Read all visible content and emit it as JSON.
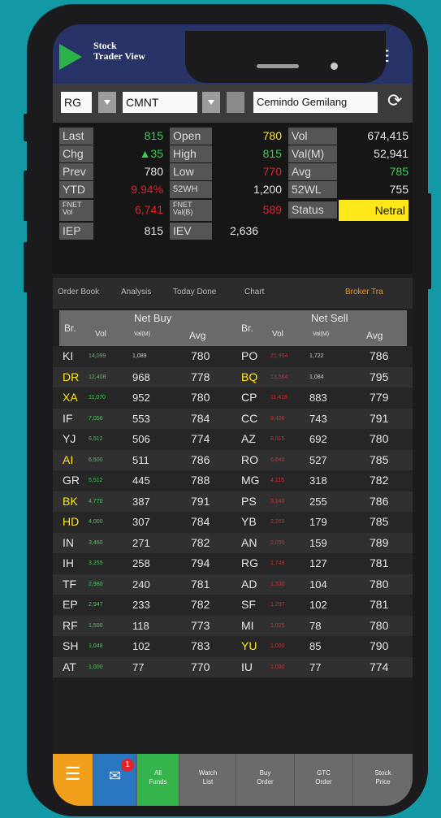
{
  "app": {
    "title_line1": "Stock",
    "title_line2": "Trader View"
  },
  "toolbar": {
    "board": "RG",
    "code": "CMNT",
    "company": "Cemindo Gemilang"
  },
  "quote": {
    "last_label": "Last",
    "last": "815",
    "chg_label": "Chg",
    "chg": "▲35",
    "prev_label": "Prev",
    "prev": "780",
    "ytd_label": "YTD",
    "ytd": "9.94%",
    "fnet_label": "FNET Vol",
    "fnet": "6,741",
    "iep_label": "IEP",
    "iep": "815",
    "open_label": "Open",
    "open": "780",
    "high_label": "High",
    "high": "815",
    "low_label": "Low",
    "low": "770",
    "wk52h_label": "52WH",
    "wk52h": "1,200",
    "fnetval_label": "FNET Val(B)",
    "fnetval": "589",
    "iev_label": "IEV",
    "iev": "2,636",
    "vol_label": "Vol",
    "vol": "674,415",
    "valm_label": "Val(M)",
    "valm": "52,941",
    "avg_label": "Avg",
    "avg": "785",
    "wk52l_label": "52WL",
    "wk52l": "755",
    "status_label": "Status",
    "status": "Netral"
  },
  "tabs": [
    "Order Book",
    "Analysis",
    "Today Done",
    "Chart",
    "Broker Tra"
  ],
  "table_header": {
    "br": "Br.",
    "net_buy": "Net Buy",
    "net_sell": "Net Sell",
    "vol": "Vol",
    "valm": "Val(M)",
    "avg": "Avg"
  },
  "rows": [
    {
      "b": "KI",
      "bv": "14,099",
      "bm": "1,089",
      "ba": "780",
      "s": "PO",
      "sv": "21,954",
      "sm": "1,722",
      "sa": "786"
    },
    {
      "b": "DR",
      "bv": "12,408",
      "bm": "968",
      "ba": "778",
      "s": "BQ",
      "sv": "13,564",
      "sm": "1,084",
      "sa": "795"
    },
    {
      "b": "XA",
      "bv": "11,070",
      "bm": "952",
      "ba": "780",
      "s": "CP",
      "sv": "11,418",
      "sm": "883",
      "sa": "779"
    },
    {
      "b": "IF",
      "bv": "7,056",
      "bm": "553",
      "ba": "784",
      "s": "CC",
      "sv": "9,406",
      "sm": "743",
      "sa": "791"
    },
    {
      "b": "YJ",
      "bv": "6,512",
      "bm": "506",
      "ba": "774",
      "s": "AZ",
      "sv": "8,015",
      "sm": "692",
      "sa": "780"
    },
    {
      "b": "AI",
      "bv": "6,500",
      "bm": "511",
      "ba": "786",
      "s": "RO",
      "sv": "6,640",
      "sm": "527",
      "sa": "785"
    },
    {
      "b": "GR",
      "bv": "5,512",
      "bm": "445",
      "ba": "788",
      "s": "MG",
      "sv": "4,115",
      "sm": "318",
      "sa": "782"
    },
    {
      "b": "BK",
      "bv": "4,770",
      "bm": "387",
      "ba": "791",
      "s": "PS",
      "sv": "3,140",
      "sm": "255",
      "sa": "786"
    },
    {
      "b": "HD",
      "bv": "4,000",
      "bm": "307",
      "ba": "784",
      "s": "YB",
      "sv": "2,269",
      "sm": "179",
      "sa": "785"
    },
    {
      "b": "IN",
      "bv": "3,460",
      "bm": "271",
      "ba": "782",
      "s": "AN",
      "sv": "2,000",
      "sm": "159",
      "sa": "789"
    },
    {
      "b": "IH",
      "bv": "3,255",
      "bm": "258",
      "ba": "794",
      "s": "RG",
      "sv": "1,749",
      "sm": "127",
      "sa": "781"
    },
    {
      "b": "TF",
      "bv": "2,980",
      "bm": "240",
      "ba": "781",
      "s": "AD",
      "sv": "1,330",
      "sm": "104",
      "sa": "780"
    },
    {
      "b": "EP",
      "bv": "2,947",
      "bm": "233",
      "ba": "782",
      "s": "SF",
      "sv": "1,297",
      "sm": "102",
      "sa": "781"
    },
    {
      "b": "RF",
      "bv": "1,500",
      "bm": "118",
      "ba": "773",
      "s": "MI",
      "sv": "1,025",
      "sm": "78",
      "sa": "780"
    },
    {
      "b": "SH",
      "bv": "1,048",
      "bm": "102",
      "ba": "783",
      "s": "YU",
      "sv": "1,000",
      "sm": "85",
      "sa": "790"
    },
    {
      "b": "AT",
      "bv": "1,000",
      "bm": "77",
      "ba": "770",
      "s": "IU",
      "sv": "1,000",
      "sm": "77",
      "sa": "774"
    }
  ],
  "bottom_nav": {
    "badge": "1",
    "all_funds_1": "All",
    "all_funds_2": "Funds",
    "watch_1": "Watch",
    "watch_2": "List",
    "buy_1": "Buy",
    "buy_2": "Order",
    "gtc_1": "GTC",
    "gtc_2": "Order",
    "stock_1": "Stock",
    "stock_2": "Price"
  },
  "colors": {
    "buy_green": "#35d24a",
    "sell_red": "#e0242a",
    "status_yellow": "#ffe81a",
    "top_navy": "#273366"
  }
}
